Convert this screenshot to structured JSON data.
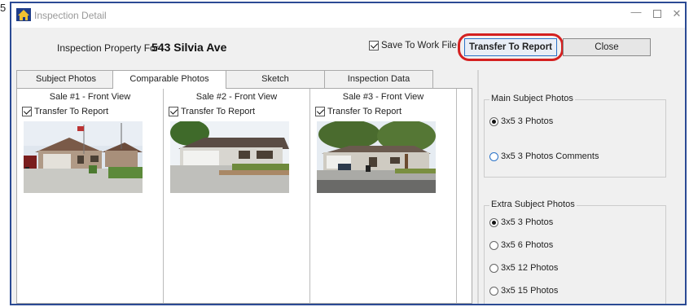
{
  "page_number": "5",
  "window": {
    "title": "Inspection Detail",
    "controls": {
      "minimize": "—",
      "close": "✕"
    }
  },
  "header": {
    "property_label": "Inspection Property For :",
    "property_value": "543 Silvia Ave",
    "save_checkbox": {
      "label": "Save To Work File",
      "checked": true
    },
    "transfer_button": "Transfer To Report",
    "close_button": "Close"
  },
  "tabs": [
    {
      "label": "Subject Photos",
      "active": false
    },
    {
      "label": "Comparable Photos",
      "active": true
    },
    {
      "label": "Sketch",
      "active": false
    },
    {
      "label": "Inspection Data",
      "active": false
    }
  ],
  "comparables": [
    {
      "title": "Sale #1 - Front View",
      "checkbox_label": "Transfer To Report",
      "checked": true,
      "photo": "house-photo"
    },
    {
      "title": "Sale #2 - Front View",
      "checkbox_label": "Transfer To Report",
      "checked": true,
      "photo": "house-photo"
    },
    {
      "title": "Sale #3 - Front View",
      "checkbox_label": "Transfer To Report",
      "checked": true,
      "photo": "house-photo"
    }
  ],
  "right_panel": {
    "main_group": {
      "legend": "Main Subject Photos",
      "options": [
        {
          "label": "3x5 3 Photos",
          "selected": true
        },
        {
          "label": "3x5 3 Photos Comments",
          "selected": false
        }
      ]
    },
    "extra_group": {
      "legend": "Extra Subject Photos",
      "options": [
        {
          "label": "3x5 3 Photos",
          "selected": true
        },
        {
          "label": "3x5 6 Photos",
          "selected": false
        },
        {
          "label": "3x5 12 Photos",
          "selected": false
        },
        {
          "label": "3x5 15 Photos",
          "selected": false
        }
      ]
    }
  },
  "colors": {
    "window_border": "#2b4a94",
    "highlight_outline": "#d42020",
    "button_focus": "#2a72c8"
  }
}
